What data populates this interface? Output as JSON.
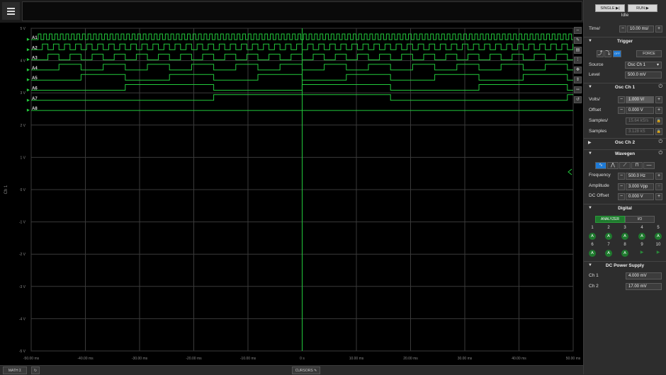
{
  "toolbar": {
    "single_label": "SINGLE",
    "run_label": "RUN",
    "status": "Idle"
  },
  "time": {
    "label": "Time/",
    "value": "10.00 ms/"
  },
  "trigger": {
    "title": "Trigger",
    "off_label": "OFF",
    "force_label": "FORCE",
    "source_label": "Source",
    "source_value": "Osc Ch 1",
    "level_label": "Level",
    "level_value": "500.0 mV"
  },
  "osc_ch1": {
    "title": "Osc Ch 1",
    "volts_label": "Volts/",
    "volts_value": "1.000 V/",
    "offset_label": "Offset",
    "offset_value": "0.000 V",
    "samples_label": "Samples/",
    "samples_value": "15.64 kS/s",
    "samples2_label": "Samples",
    "samples2_value": "3.128 kS"
  },
  "osc_ch2": {
    "title": "Osc Ch 2"
  },
  "wavegen": {
    "title": "Wavegen",
    "frequency_label": "Frequency",
    "frequency_value": "500.0 Hz",
    "amplitude_label": "Amplitude",
    "amplitude_value": "3.000 Vpp",
    "dc_offset_label": "DC Offset",
    "dc_offset_value": "0.000 V"
  },
  "digital": {
    "title": "Digital",
    "analyzer_label": "ANALYZER",
    "io_label": "I/O",
    "pins": [
      {
        "num": "1",
        "state": "A"
      },
      {
        "num": "2",
        "state": "A"
      },
      {
        "num": "3",
        "state": "A"
      },
      {
        "num": "4",
        "state": "A"
      },
      {
        "num": "5",
        "state": "A"
      },
      {
        "num": "6",
        "state": "A"
      },
      {
        "num": "7",
        "state": "A"
      },
      {
        "num": "8",
        "state": "A"
      },
      {
        "num": "9",
        "state": "▶"
      },
      {
        "num": "10",
        "state": "▶"
      }
    ]
  },
  "dc_power": {
    "title": "DC Power Supply",
    "ch1_label": "Ch 1",
    "ch1_value": "4.000 mV",
    "ch2_label": "Ch 2",
    "ch2_value": "17.00 mV"
  },
  "bottom": {
    "math_label": "MATH",
    "cursors_label": "CURSORS"
  },
  "plot": {
    "channel_label": "Ch 1",
    "y_ticks": [
      "5 V",
      "4 V",
      "3 V",
      "2 V",
      "1 V",
      "0 V",
      "-1 V",
      "-2 V",
      "-3 V",
      "-4 V",
      "-5 V"
    ],
    "x_ticks": [
      "-50.00 ms",
      "-40.00 ms",
      "-30.00 ms",
      "-20.00 ms",
      "-10.00 ms",
      "0 s",
      "10.00 ms",
      "20.00 ms",
      "30.00 ms",
      "40.00 ms",
      "50.00 ms"
    ],
    "digital_channels": [
      "A1",
      "A2",
      "A3",
      "A4",
      "A5",
      "A6",
      "A7",
      "A8"
    ],
    "trace_color": "#22c93c"
  },
  "colors": {
    "accent": "#1e7ad6",
    "trace": "#22c93c",
    "analyzer": "#1f7a2e"
  }
}
